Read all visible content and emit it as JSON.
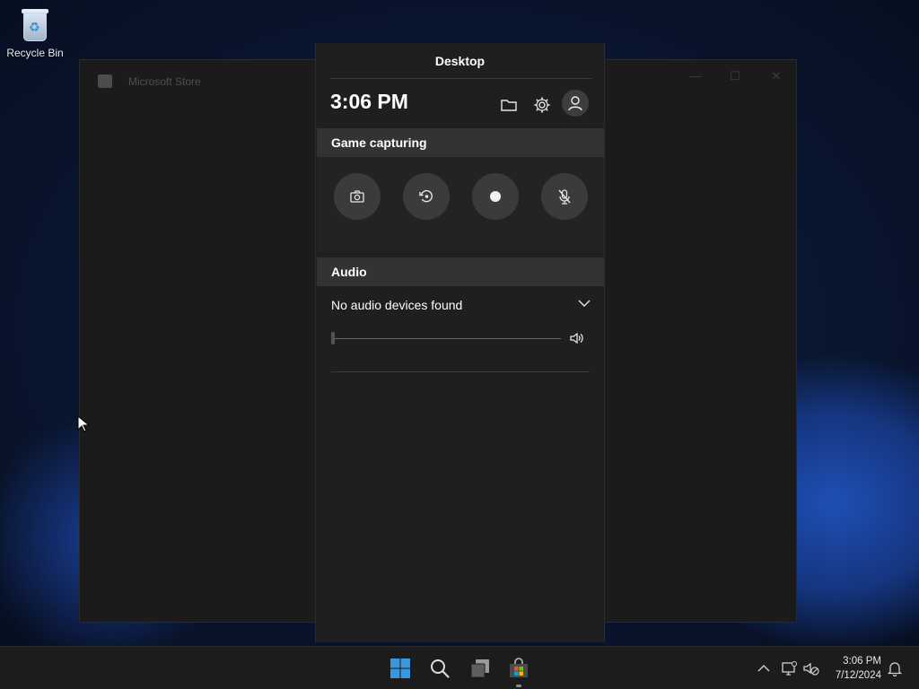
{
  "desktop": {
    "recycle_bin_label": "Recycle Bin"
  },
  "store_window": {
    "title": "Microsoft Store",
    "icon": "store-bag-icon",
    "controls": [
      "minimize-icon",
      "maximize-icon",
      "close-icon"
    ]
  },
  "gamebar": {
    "title": "Desktop",
    "time": "3:06 PM",
    "top_icons": [
      "folder-icon",
      "gear-icon",
      "user-icon"
    ],
    "capture": {
      "header": "Game capturing",
      "buttons": [
        "camera-icon",
        "record-last-icon",
        "record-dot-icon",
        "mic-off-icon"
      ]
    },
    "audio": {
      "header": "Audio",
      "device_label": "No audio devices found",
      "volume_level": 0
    }
  },
  "taskbar": {
    "apps": [
      "windows-start-icon",
      "search-icon",
      "task-view-icon",
      "microsoft-store-icon"
    ],
    "tray_icons": [
      "chevron-up-icon",
      "network-icon",
      "speaker-muted-icon",
      "notification-icon"
    ],
    "clock": {
      "time": "3:06 PM",
      "date": "7/12/2024"
    }
  },
  "colors": {
    "panel_bg": "#1f1f1f",
    "section_header_bg": "#333333",
    "capture_button_bg": "#3b3b3b",
    "taskbar_bg": "#1c1c1c",
    "windows_blue": "#3a96dd"
  }
}
